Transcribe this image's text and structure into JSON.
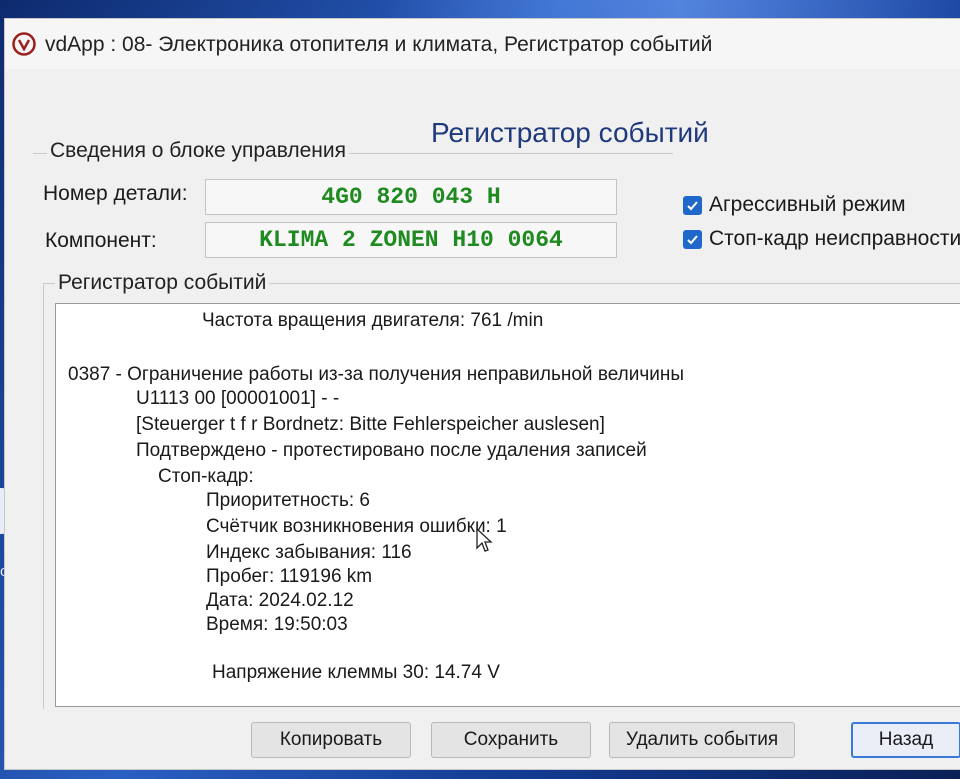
{
  "window": {
    "title": "vdApp : 08- Электроника отопителя и климата,  Регистратор событий"
  },
  "header": {
    "title": "Регистратор событий"
  },
  "control_unit": {
    "group_label": "Сведения о блоке управления",
    "part_number_label": "Номер детали:",
    "part_number_value": "4G0 820 043 H",
    "component_label": "Компонент:",
    "component_value": "KLIMA 2 ZONEN H10 0064"
  },
  "options": {
    "aggressive_mode": {
      "label": "Агрессивный режим",
      "checked": true
    },
    "freeze_frame": {
      "label": "Стоп-кадр неисправности",
      "checked": true
    }
  },
  "event_log": {
    "group_label": "Регистратор событий",
    "lines": [
      "Частота вращения двигателя: 761 /min",
      "0387 - Ограничение работы из-за получения неправильной величины",
      "U1113 00 [00001001] - -",
      "[Steuerger t f r Bordnetz: Bitte Fehlerspeicher auslesen]",
      "Подтверждено - протестировано после удаления записей",
      "Стоп-кадр:",
      "Приоритетность: 6",
      "Счётчик возникновения ошибки: 1",
      "Индекс забывания: 116",
      "Пробег: 119196 km",
      "Дата: 2024.02.12",
      "Время: 19:50:03",
      "Напряжение клеммы 30: 14.74 V"
    ]
  },
  "buttons": {
    "copy": "Копировать",
    "save": "Сохранить",
    "delete_events": "Удалить события",
    "back": "Назад"
  },
  "desktop": {
    "taskbar_app_label": "corc"
  },
  "colors": {
    "accent": "#1f68c9",
    "value_text": "#1f8a1f",
    "header_text": "#1f3a7c"
  }
}
